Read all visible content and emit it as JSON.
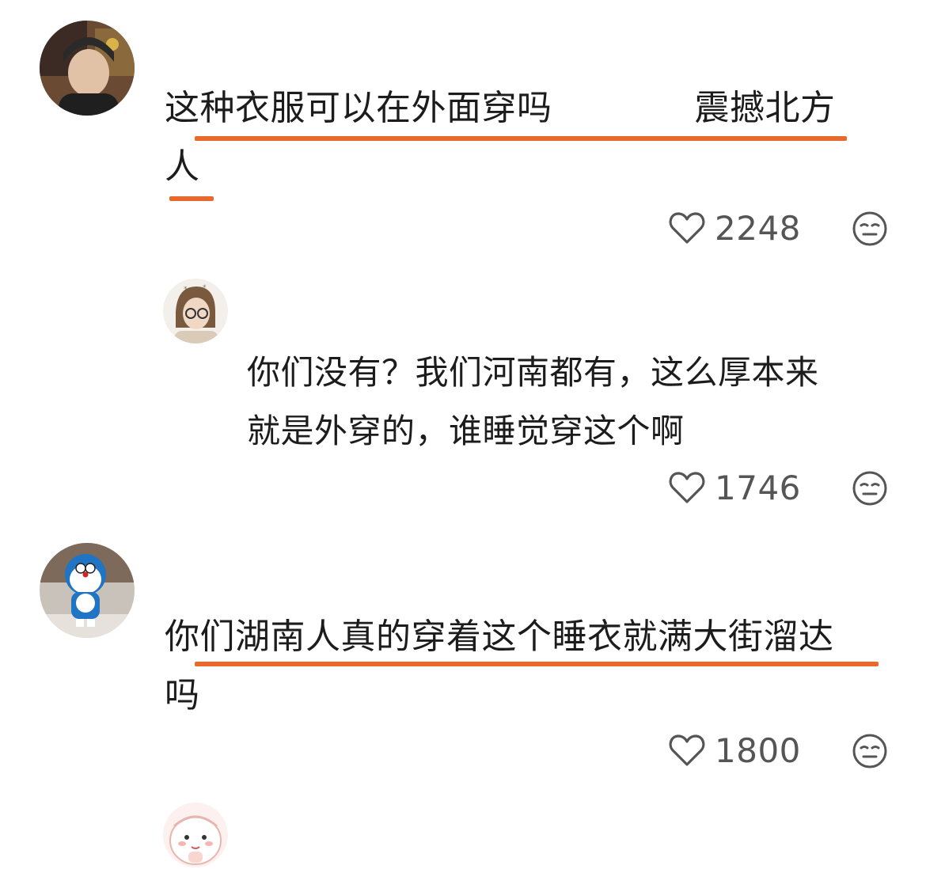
{
  "comments": [
    {
      "text_line1_a": "这种衣服可以在外面穿吗",
      "text_line1_b": "震撼北方",
      "text_line2": "人",
      "likes": "2248"
    },
    {
      "text_line1": "你们没有？我们河南都有，这么厚本来",
      "text_line2": "就是外穿的，谁睡觉穿这个啊",
      "likes": "1746"
    },
    {
      "text_line1": "你们湖南人真的穿着这个睡衣就满大街溜达",
      "text_line2": "吗",
      "likes": "1800"
    }
  ],
  "icons": {
    "like": "heart-outline-icon",
    "emoji": "neutral-face-icon"
  },
  "colors": {
    "underline": "#e8692c",
    "count_text": "#555555",
    "icon_stroke": "#555555"
  }
}
